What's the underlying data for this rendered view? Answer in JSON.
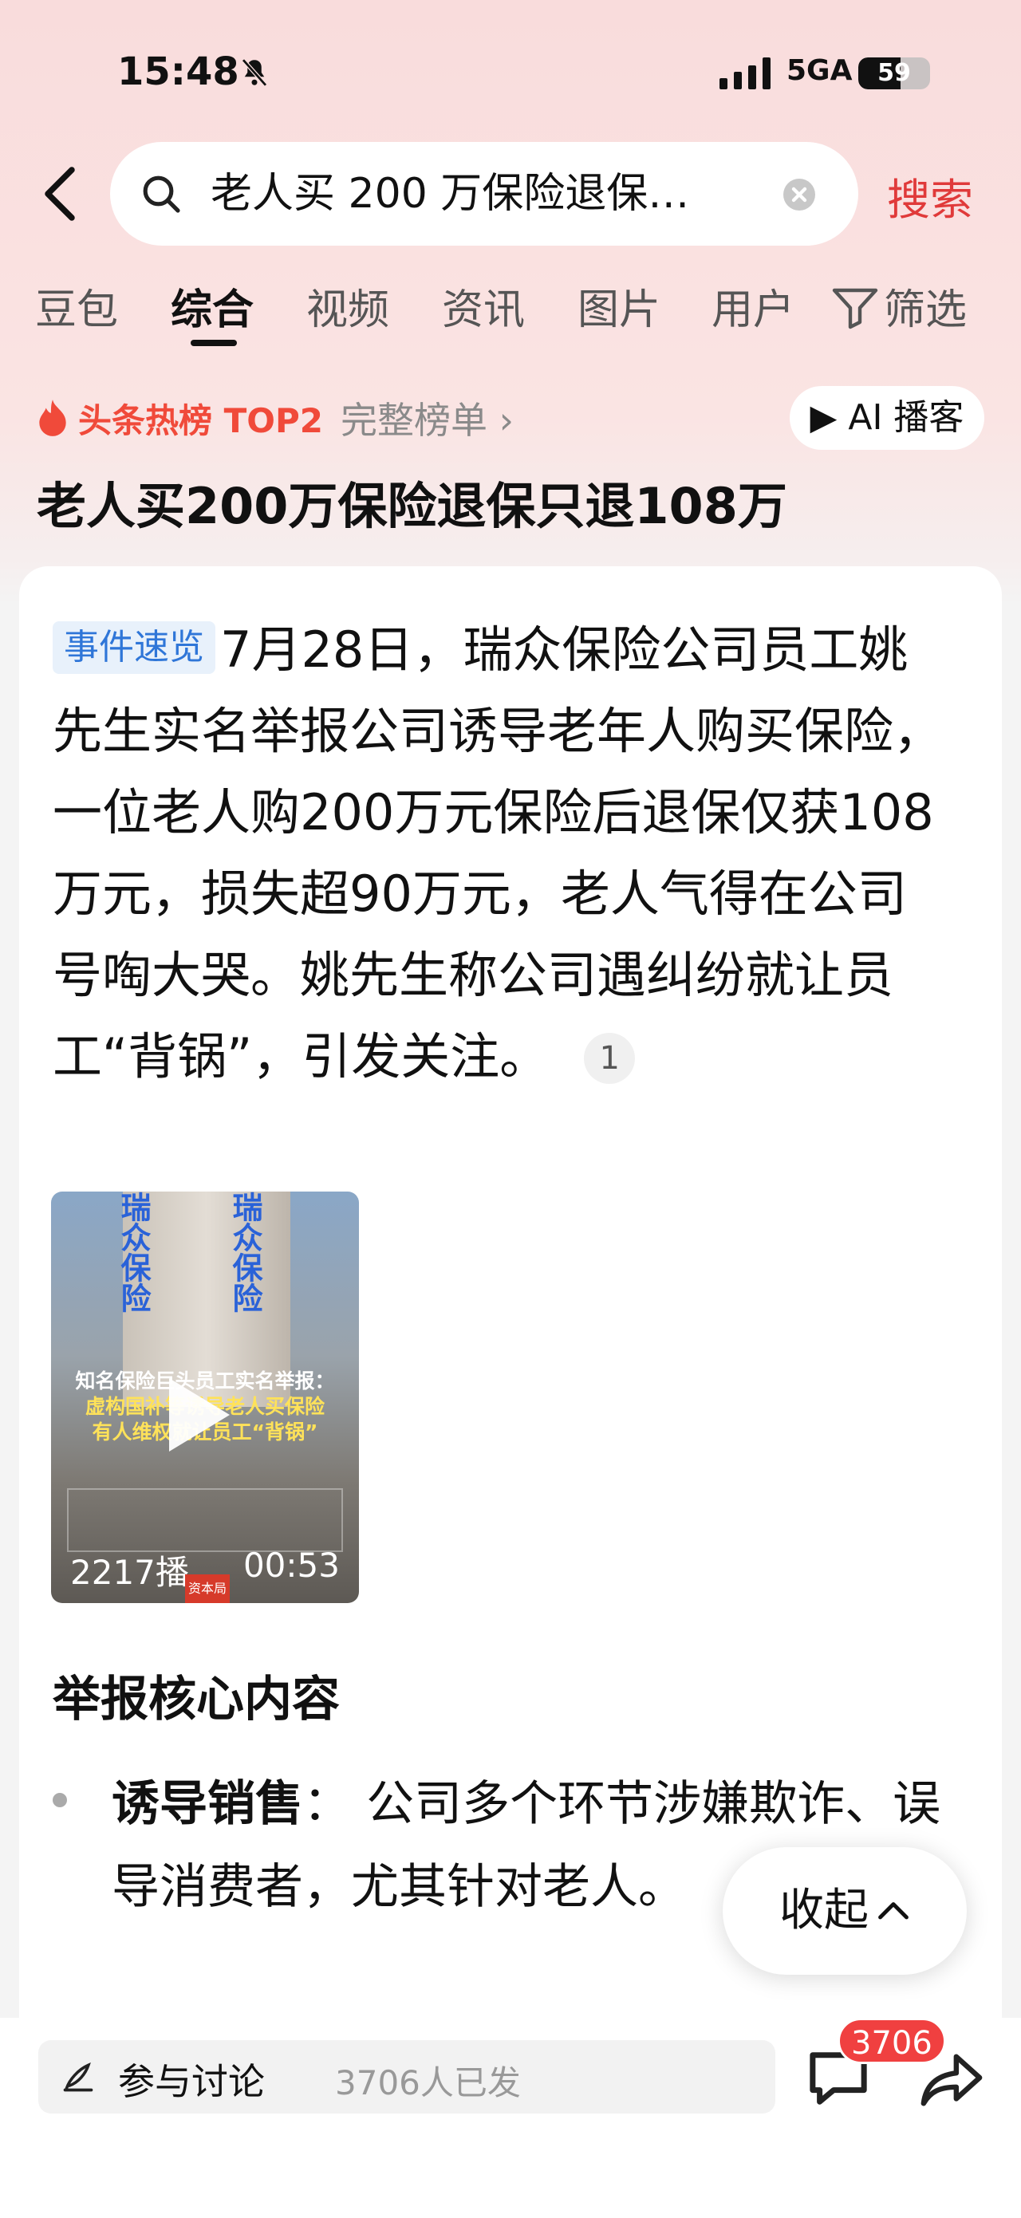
{
  "status_bar": {
    "time": "15:48",
    "network": "5GA",
    "battery": "59",
    "battery_level": 0.59
  },
  "search": {
    "query": "老人买 200 万保险退保…",
    "button": "搜索"
  },
  "tabs": [
    "豆包",
    "综合",
    "视频",
    "资讯",
    "图片",
    "用户"
  ],
  "active_tab": "综合",
  "filter_label": "筛选",
  "hot_rank": {
    "label": "头条热榜 TOP2",
    "more": "完整榜单 ›"
  },
  "ai_podcast": "▶ AI 播客",
  "headline": "老人买200万保险退保只退108万",
  "summary": {
    "tag": "事件速览",
    "text": "7月28日，瑞众保险公司员工姚先生实名举报公司诱导老年人购买保险，一位老人购200万元保险后退保仅获108万元，损失超90万元，老人气得在公司号啕大哭。姚先生称公司遇纠纷就让员工“背锅”，引发关注。",
    "citation": "1"
  },
  "video": {
    "sign_text": "瑞众保险",
    "caption_line1": "知名保险巨头员工实名举报：",
    "caption_line2": "虚构国补等诱导老人买保险",
    "caption_line3": "有人维权就让员工“背锅”",
    "views": "2217播…",
    "duration": "00:53",
    "logo_text": "资本局"
  },
  "section": {
    "title": "举报核心内容",
    "bullet_term": "诱导销售",
    "bullet_sep": "：",
    "bullet_text": "公司多个环节涉嫌欺诈、误导消费者，尤其针对老人。"
  },
  "collapse_button": "收起",
  "bottom_bar": {
    "discuss_label": "参与讨论",
    "discuss_count": "3706人已发",
    "comment_badge": "3706"
  },
  "colors": {
    "accent_red": "#e03a3a",
    "tag_blue": "#2f76d8"
  }
}
